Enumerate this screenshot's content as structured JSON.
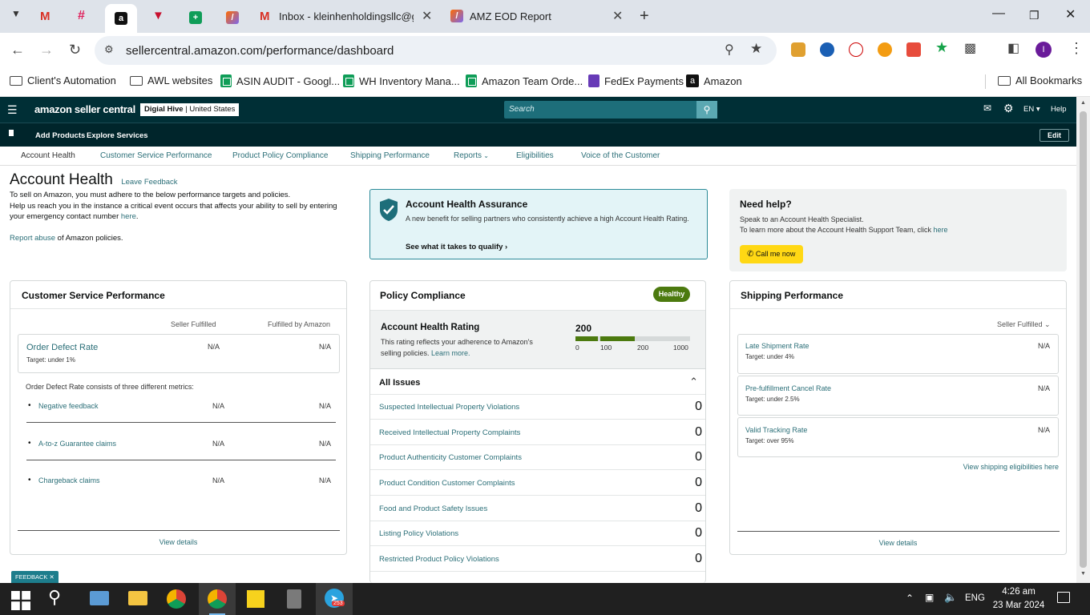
{
  "browser": {
    "tabs": [
      {
        "title": "",
        "icon": "gmail-icon"
      },
      {
        "title": "",
        "icon": "slack-icon"
      },
      {
        "title": "",
        "icon": "amazon-icon",
        "active": true
      },
      {
        "title": "",
        "icon": "vpn-icon"
      },
      {
        "title": "",
        "icon": "sheets-icon"
      },
      {
        "title": "",
        "icon": "clickup-icon"
      },
      {
        "title": "Inbox - kleinhenholdingsllc@gm",
        "icon": "gmail-icon"
      },
      {
        "title": "AMZ EOD Report",
        "icon": "clickup-icon"
      }
    ],
    "url": "sellercentral.amazon.com/performance/dashboard",
    "profile_initial": "I",
    "bookmarks": [
      "Client's Automation",
      "AWL websites",
      "ASIN AUDIT - Googl...",
      "WH Inventory Mana...",
      "Amazon Team Orde...",
      "FedEx Payments",
      "Amazon"
    ],
    "all_bookmarks": "All Bookmarks"
  },
  "header": {
    "logo": "amazon seller central",
    "store_name": "Digial Hive",
    "store_region": "United States",
    "search_placeholder": "Search",
    "lang": "EN",
    "help": "Help",
    "sub_links": [
      "Add Products",
      "Explore Services"
    ],
    "edit": "Edit"
  },
  "nav": [
    "Account Health",
    "Customer Service Performance",
    "Product Policy Compliance",
    "Shipping Performance",
    "Reports",
    "Eligibilities",
    "Voice of the Customer"
  ],
  "intro": {
    "title": "Account Health",
    "feedback": "Leave Feedback",
    "line1": "To sell on Amazon, you must adhere to the below performance targets and policies.",
    "line2": "Help us reach you in the instance a critical event occurs that affects your ability to sell by entering",
    "line3": "your emergency contact number ",
    "line3_link": "here",
    "report_link": "Report abuse",
    "report_rest": " of Amazon policies."
  },
  "assurance": {
    "title": "Account Health Assurance",
    "body": "A new benefit for selling partners who consistently achieve a high Account Health Rating.",
    "link": "See what it takes to qualify"
  },
  "help_box": {
    "title": "Need help?",
    "line1": "Speak to an Account Health Specialist.",
    "line2": "To learn more about the Account Health Support Team, click ",
    "line2_link": "here",
    "call_button": "Call me now"
  },
  "customer_service": {
    "title": "Customer Service Performance",
    "col1": "Seller Fulfilled",
    "col2": "Fulfilled by Amazon",
    "odr_label": "Order Defect Rate",
    "odr_target": "Target: under 1%",
    "odr_v1": "N/A",
    "odr_v2": "N/A",
    "metrics_intro": "Order Defect Rate consists of three different metrics:",
    "metrics": [
      {
        "label": "Negative feedback",
        "v1": "N/A",
        "v2": "N/A"
      },
      {
        "label": "A-to-z Guarantee claims",
        "v1": "N/A",
        "v2": "N/A"
      },
      {
        "label": "Chargeback claims",
        "v1": "N/A",
        "v2": "N/A"
      }
    ],
    "view_details": "View details"
  },
  "policy": {
    "title": "Policy Compliance",
    "badge": "Healthy",
    "ahr_title": "Account Health Rating",
    "ahr_body1": "This rating reflects your adherence to Amazon's",
    "ahr_body2": "selling policies. ",
    "ahr_learn": "Learn more.",
    "ahr_score": "200",
    "ahr_score_value": 200,
    "scale": [
      "0",
      "100",
      "200",
      "1000"
    ],
    "issues_title": "All Issues",
    "issues": [
      {
        "label": "Suspected Intellectual Property Violations",
        "count": "0"
      },
      {
        "label": "Received Intellectual Property Complaints",
        "count": "0"
      },
      {
        "label": "Product Authenticity Customer Complaints",
        "count": "0"
      },
      {
        "label": "Product Condition Customer Complaints",
        "count": "0"
      },
      {
        "label": "Food and Product Safety Issues",
        "count": "0"
      },
      {
        "label": "Listing Policy Violations",
        "count": "0"
      },
      {
        "label": "Restricted Product Policy Violations",
        "count": "0"
      }
    ]
  },
  "shipping": {
    "title": "Shipping Performance",
    "filter": "Seller Fulfilled",
    "metrics": [
      {
        "label": "Late Shipment Rate",
        "target": "Target: under 4%",
        "value": "N/A"
      },
      {
        "label": "Pre-fulfillment Cancel Rate",
        "target": "Target: under 2.5%",
        "value": "N/A"
      },
      {
        "label": "Valid Tracking Rate",
        "target": "Target: over 95%",
        "value": "N/A"
      }
    ],
    "eligibility_link": "View shipping eligibilities here",
    "view_details": "View details"
  },
  "feedback_tab": "FEEDBACK",
  "taskbar": {
    "lang": "ENG",
    "time": "4:26 am",
    "date": "23 Mar 2024",
    "telegram_badge": "253"
  },
  "colors": {
    "header_bg": "#002f36",
    "link": "#2b6f78",
    "healthy": "#4c7a0f",
    "assurance_bg": "#e3f4f7",
    "call_button": "#ffd814"
  }
}
